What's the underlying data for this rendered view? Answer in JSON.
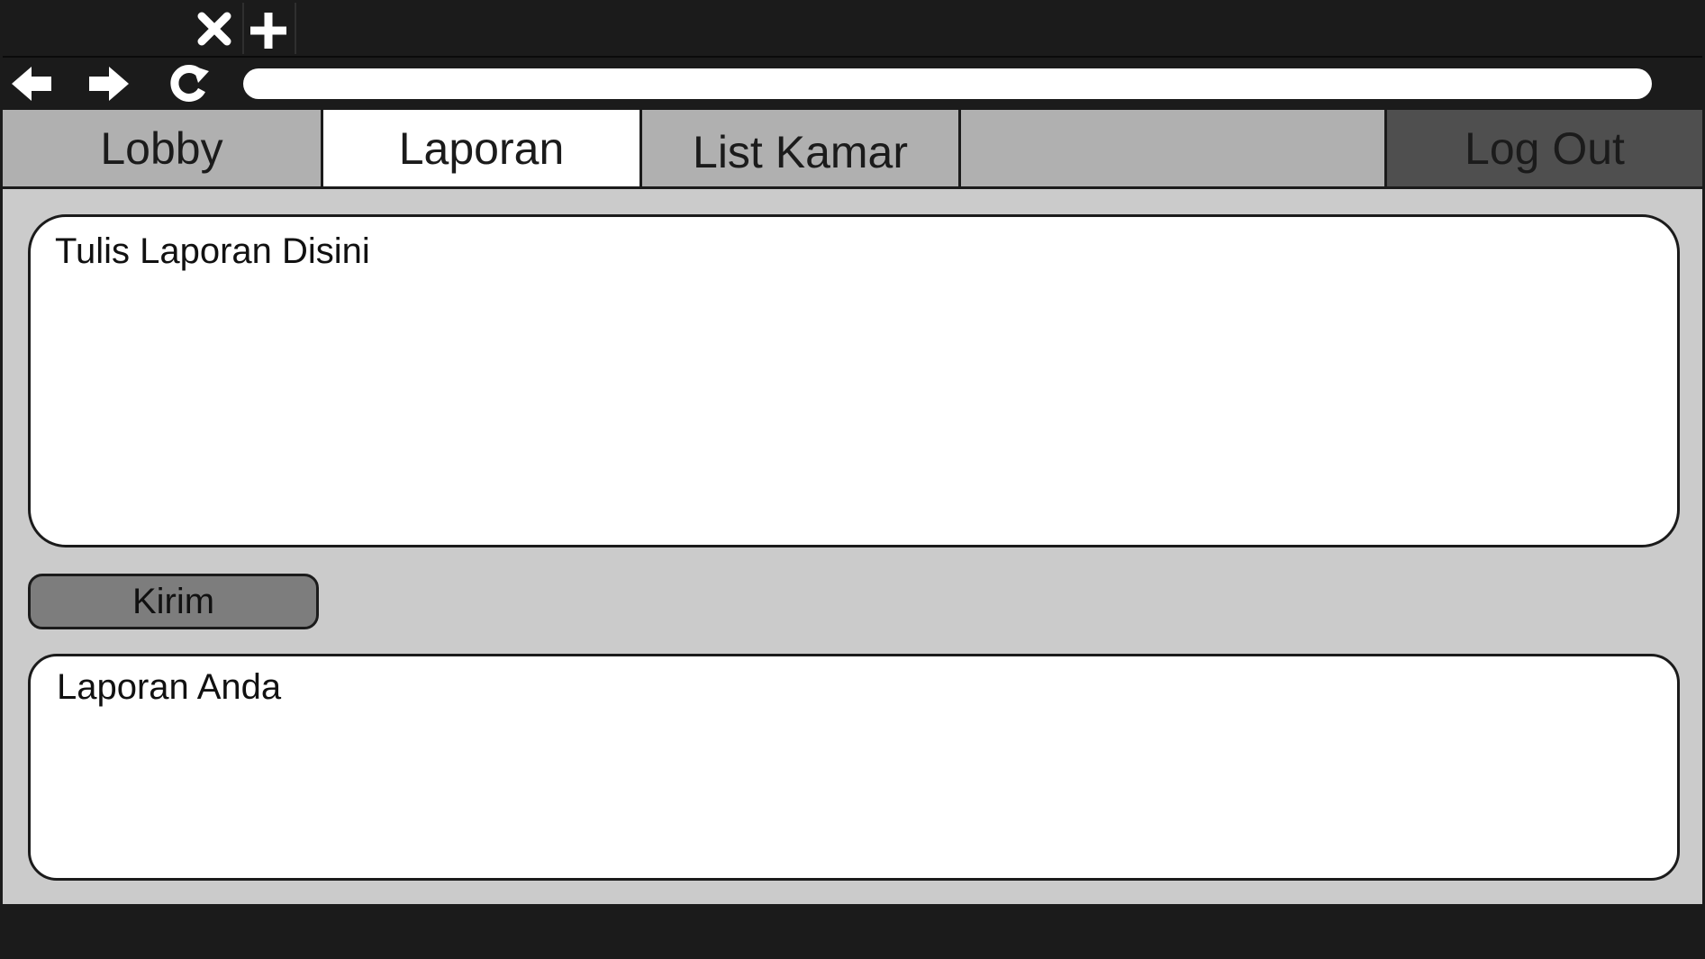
{
  "browser": {
    "toolbar_icons": [
      "close-tab-icon",
      "new-tab-icon",
      "back-arrow-icon",
      "forward-arrow-icon",
      "reload-icon"
    ],
    "address_bar_value": ""
  },
  "nav": {
    "tabs": [
      {
        "label": "Lobby",
        "active": false
      },
      {
        "label": "Laporan",
        "active": true
      },
      {
        "label": "List Kamar",
        "active": false
      }
    ],
    "logout_label": "Log Out"
  },
  "report_form": {
    "placeholder": "Tulis Laporan Disini",
    "value": "",
    "submit_label": "Kirim"
  },
  "report_list": {
    "title": "Laporan Anda"
  },
  "colors": {
    "chrome": "#1b1b1b",
    "tab_bar": "#b0b0b0",
    "active_tab": "#ffffff",
    "logout_tab": "#4f4f4f",
    "content_background": "#cbcbcb",
    "submit_button": "#7d7d7d"
  }
}
